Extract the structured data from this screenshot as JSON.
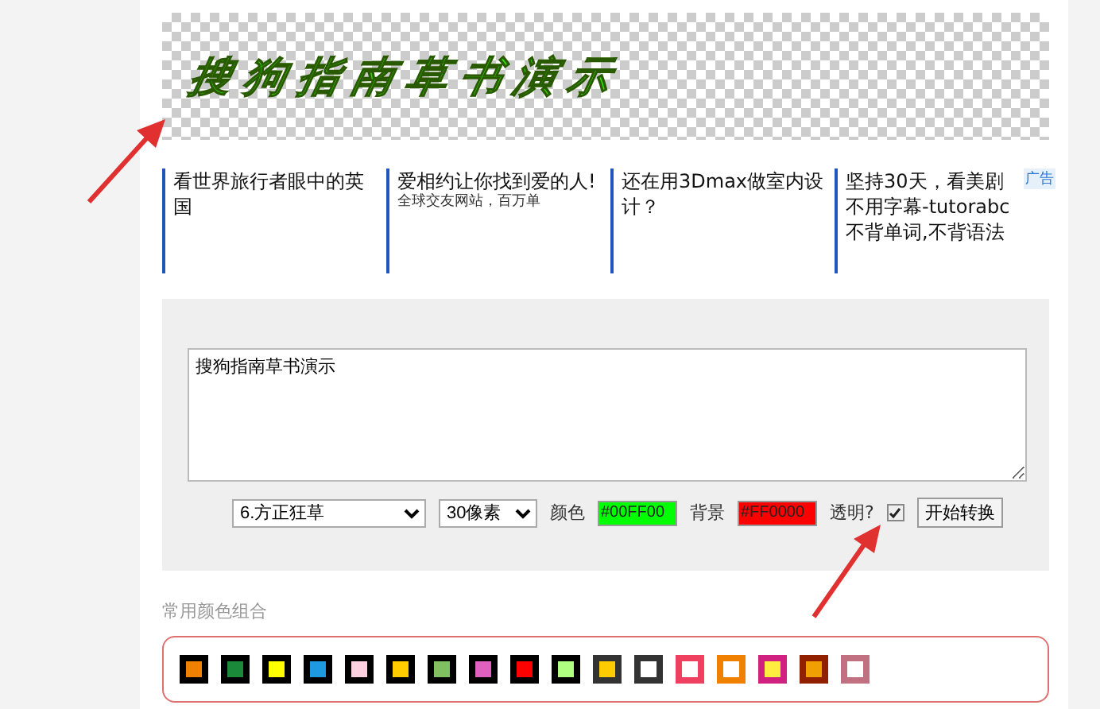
{
  "preview": {
    "text": "搜狗指南草书演示",
    "color": "#33dd00"
  },
  "ads": [
    {
      "title": "看世界旅行者眼中的英国"
    },
    {
      "title": "爱相约让你找到爱的人!",
      "desc": "全球交友网站，百万单"
    },
    {
      "title": "还在用3Dmax做室内设计？"
    },
    {
      "title": "坚持30天，看美剧不用字幕-tutorabc不背单词,不背语法"
    }
  ],
  "ad_badge": "广告",
  "form": {
    "text": "搜狗指南草书演示",
    "font": "6.方正狂草",
    "size": "30像素",
    "color_label": "颜色",
    "color_field": {
      "value": "#00FF00",
      "color": "#00ff00"
    },
    "bg_label": "背景",
    "bg_field": {
      "value": "#FF0000",
      "color": "#ff0000"
    },
    "transparent_label": "透明?",
    "transparent": true,
    "button": "开始转换"
  },
  "palette": {
    "title": "常用颜色组合",
    "swatches": [
      {
        "frame": {
          "color": "#000000"
        },
        "color": "#f08000"
      },
      {
        "frame": {
          "color": "#000000"
        },
        "color": "#1a8a3a"
      },
      {
        "frame": {
          "color": "#000000"
        },
        "color": "#ffff00"
      },
      {
        "frame": {
          "color": "#000000"
        },
        "color": "#1e9be0"
      },
      {
        "frame": {
          "color": "#000000"
        },
        "color": "#ffd0e0"
      },
      {
        "frame": {
          "color": "#000000"
        },
        "color": "#ffcc00"
      },
      {
        "frame": {
          "color": "#000000"
        },
        "color": "#80c060"
      },
      {
        "frame": {
          "color": "#000000"
        },
        "color": "#e060c0"
      },
      {
        "frame": {
          "color": "#000000"
        },
        "color": "#ff0000"
      },
      {
        "frame": {
          "color": "#000000"
        },
        "color": "#b0ff80"
      },
      {
        "frame": {
          "color": "#333333"
        },
        "color": "#ffcc00"
      },
      {
        "frame": {
          "color": "#333333"
        },
        "color": "#ffffff"
      },
      {
        "frame": {
          "color": "#f04060"
        },
        "color": "#ffffff"
      },
      {
        "frame": {
          "color": "#f08000"
        },
        "color": "#ffffff"
      },
      {
        "frame": {
          "color": "#d02080"
        },
        "color": "#ffee40"
      },
      {
        "frame": {
          "color": "#902000"
        },
        "color": "#f0a000"
      },
      {
        "frame": {
          "color": "#c07080"
        },
        "color": "#ffffff"
      }
    ]
  }
}
